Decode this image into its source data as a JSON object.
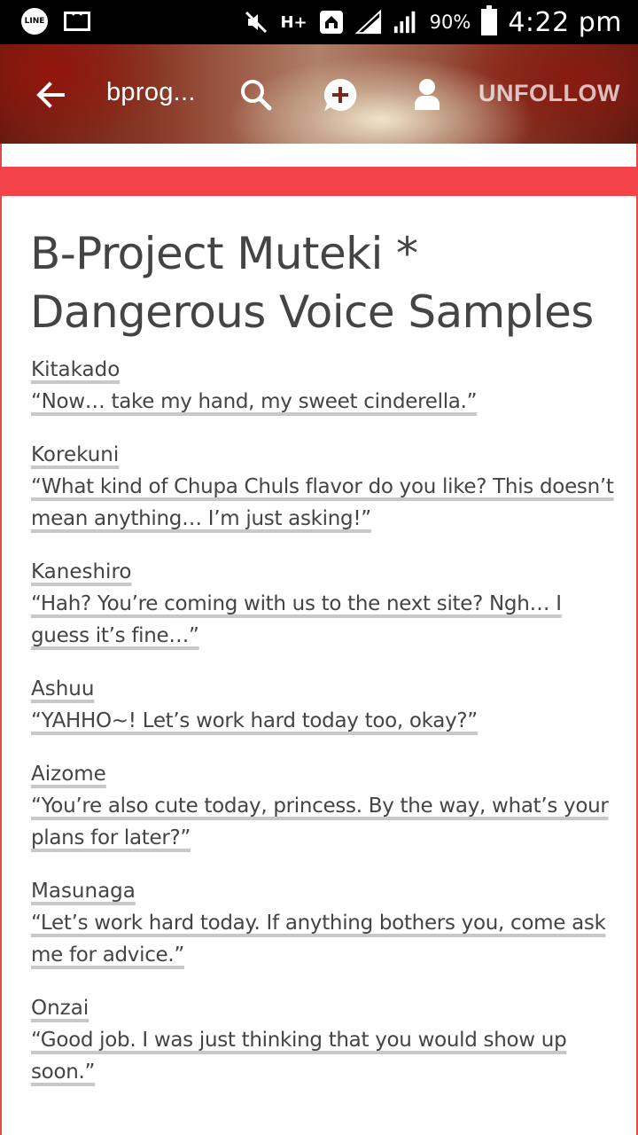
{
  "status_bar": {
    "line_label": "LINE",
    "network_label": "H+",
    "battery_percent": "90%",
    "time": "4:22 pm",
    "icons": [
      "line-icon",
      "mail-icon",
      "mute-icon",
      "network-h-plus-icon",
      "home-icon",
      "signal-icon",
      "signal-icon",
      "battery-icon"
    ]
  },
  "header": {
    "title": "bprog...",
    "unfollow_label": "UNFOLLOW",
    "icons": [
      "back-arrow-icon",
      "search-icon",
      "compose-icon",
      "user-icon"
    ]
  },
  "colors": {
    "accent_red": "#f2434a",
    "text": "#444444",
    "underline": "#c8c8c8"
  },
  "post": {
    "title": "B-Project Muteki * Dangerous Voice Samples",
    "entries": [
      {
        "name": "Kitakado",
        "quote": "“Now… take my hand, my sweet cinderella.”"
      },
      {
        "name": "Korekuni",
        "quote": "“What kind of Chupa Chuls flavor do you like? This doesn’t mean anything… I’m just asking!”"
      },
      {
        "name": "Kaneshiro",
        "quote": "“Hah? You’re coming with us to the next site? Ngh… I guess it’s fine…”"
      },
      {
        "name": "Ashuu",
        "quote": "“YAHHO~! Let’s work hard today too, okay?”"
      },
      {
        "name": "Aizome",
        "quote": "“You’re also cute today, princess. By the way, what’s your plans for later?”"
      },
      {
        "name": "Masunaga",
        "quote": "“Let’s work hard today. If anything bothers you, come ask me for advice.”"
      },
      {
        "name": "Onzai",
        "quote": "“Good job. I was just thinking that you would show up soon.”"
      }
    ]
  }
}
